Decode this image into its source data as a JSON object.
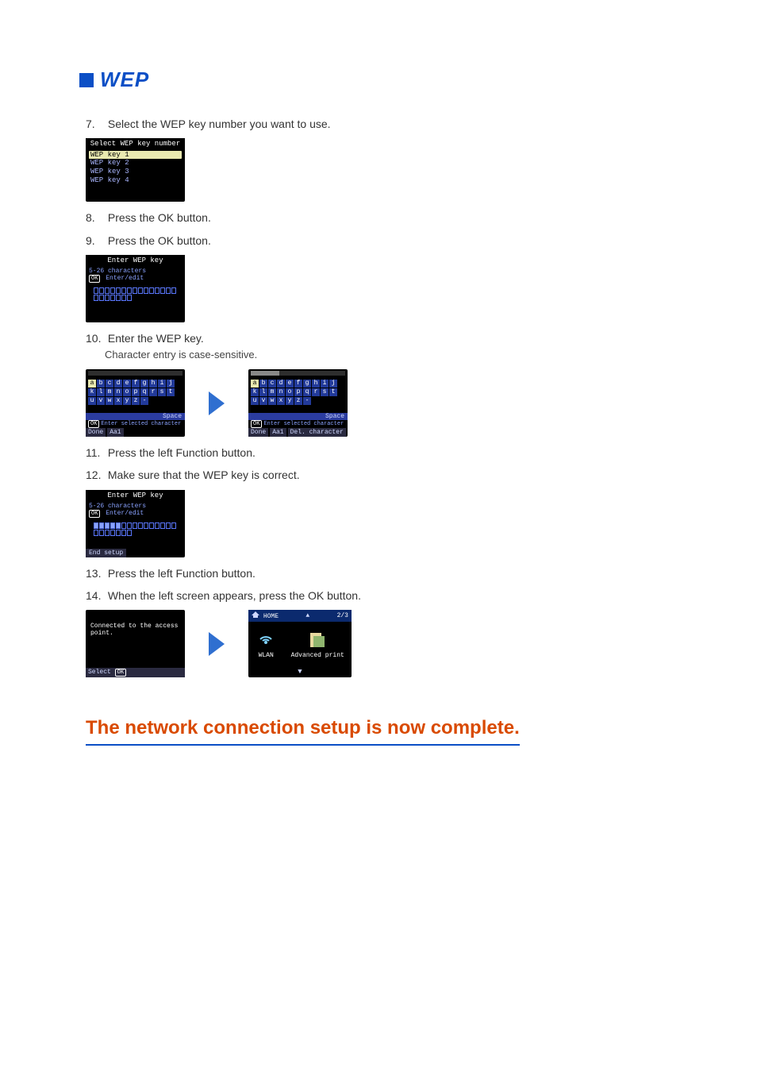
{
  "heading": "WEP",
  "steps": {
    "s7": {
      "num": "7.",
      "text": "Select the WEP key number you want to use."
    },
    "s8": {
      "num": "8.",
      "text": "Press the OK button."
    },
    "s9": {
      "num": "9.",
      "text": "Press the OK button."
    },
    "s10": {
      "num": "10.",
      "text": "Enter the WEP key.",
      "sub": "Character entry is case-sensitive."
    },
    "s11": {
      "num": "11.",
      "text": "Press the left Function button."
    },
    "s12": {
      "num": "12.",
      "text": "Make sure that the WEP key is correct."
    },
    "s13": {
      "num": "13.",
      "text": "Press the left Function button."
    },
    "s14": {
      "num": "14.",
      "text": "When the left screen appears, press the OK button."
    }
  },
  "lcd": {
    "select_title": "Select WEP key number",
    "keys": [
      "WEP key 1",
      "WEP key 2",
      "WEP key 3",
      "WEP key 4"
    ],
    "enter_title": "Enter WEP key",
    "enter_help1": "5-26 characters",
    "enter_help2": "Enter/edit",
    "ok": "OK",
    "kbd": {
      "rows": [
        [
          "a",
          "b",
          "c",
          "d",
          "e",
          "f",
          "g",
          "h",
          "i",
          "j"
        ],
        [
          "k",
          "l",
          "m",
          "n",
          "o",
          "p",
          "q",
          "r",
          "s",
          "t"
        ],
        [
          "u",
          "v",
          "w",
          "x",
          "y",
          "z",
          "-",
          "",
          "",
          ""
        ]
      ],
      "space": "Space",
      "help": "Enter selected character",
      "done": "Done",
      "mode": "Aa1",
      "del": "Del. character"
    },
    "end_setup": "End setup",
    "connected_msg": "Connected to the access point.",
    "select_ok": "Select",
    "home": {
      "label": "HOME",
      "page": "2/3",
      "wlan": "WLAN",
      "adv": "Advanced print"
    }
  },
  "complete": "The network connection setup is now complete."
}
